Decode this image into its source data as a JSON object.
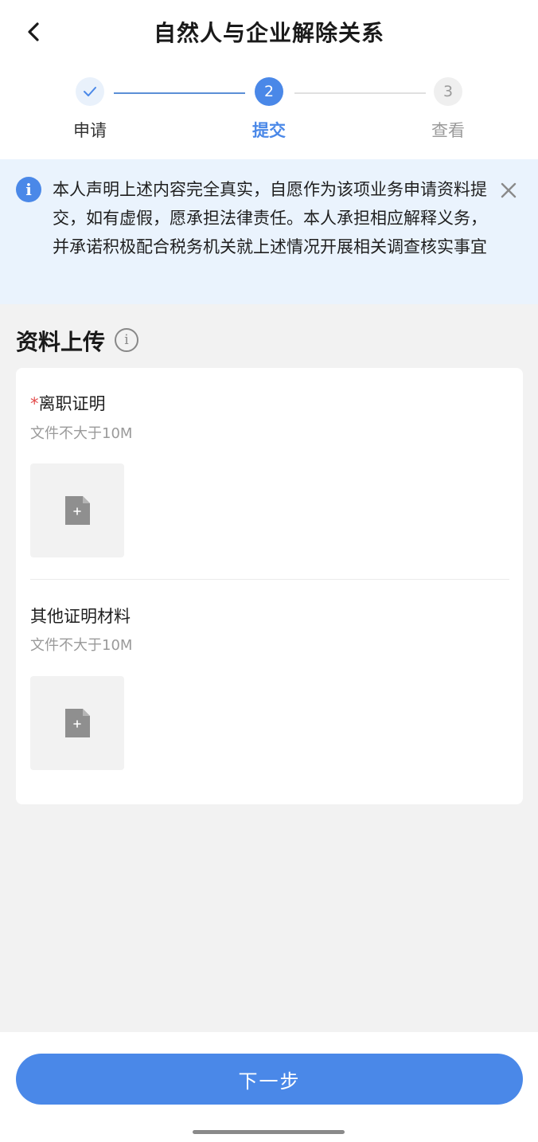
{
  "header": {
    "title": "自然人与企业解除关系",
    "back_icon": "chevron-left-icon"
  },
  "steps": [
    {
      "number": "",
      "label": "申请",
      "state": "done",
      "icon": "check-icon"
    },
    {
      "number": "2",
      "label": "提交",
      "state": "active"
    },
    {
      "number": "3",
      "label": "查看",
      "state": "todo"
    }
  ],
  "notice": {
    "icon": "info-filled-icon",
    "text": "本人声明上述内容完全真实，自愿作为该项业务申请资料提交，如有虚假，愿承担法律责任。本人承担相应解释义务，并承诺积极配合税务机关就上述情况开展相关调查核实事宜",
    "close_icon": "close-icon"
  },
  "upload_section": {
    "title": "资料上传",
    "info_icon": "info-outline-icon",
    "fields": [
      {
        "required_mark": "*",
        "label": "离职证明",
        "hint": "文件不大于10M",
        "upload_icon": "file-add-icon"
      },
      {
        "required_mark": "",
        "label": "其他证明材料",
        "hint": "文件不大于10M",
        "upload_icon": "file-add-icon"
      }
    ]
  },
  "footer": {
    "next_label": "下一步"
  },
  "colors": {
    "primary": "#4a88e8",
    "notice_bg": "#eaf3fd",
    "page_bg": "#f2f2f2",
    "required": "#e34d4d"
  }
}
